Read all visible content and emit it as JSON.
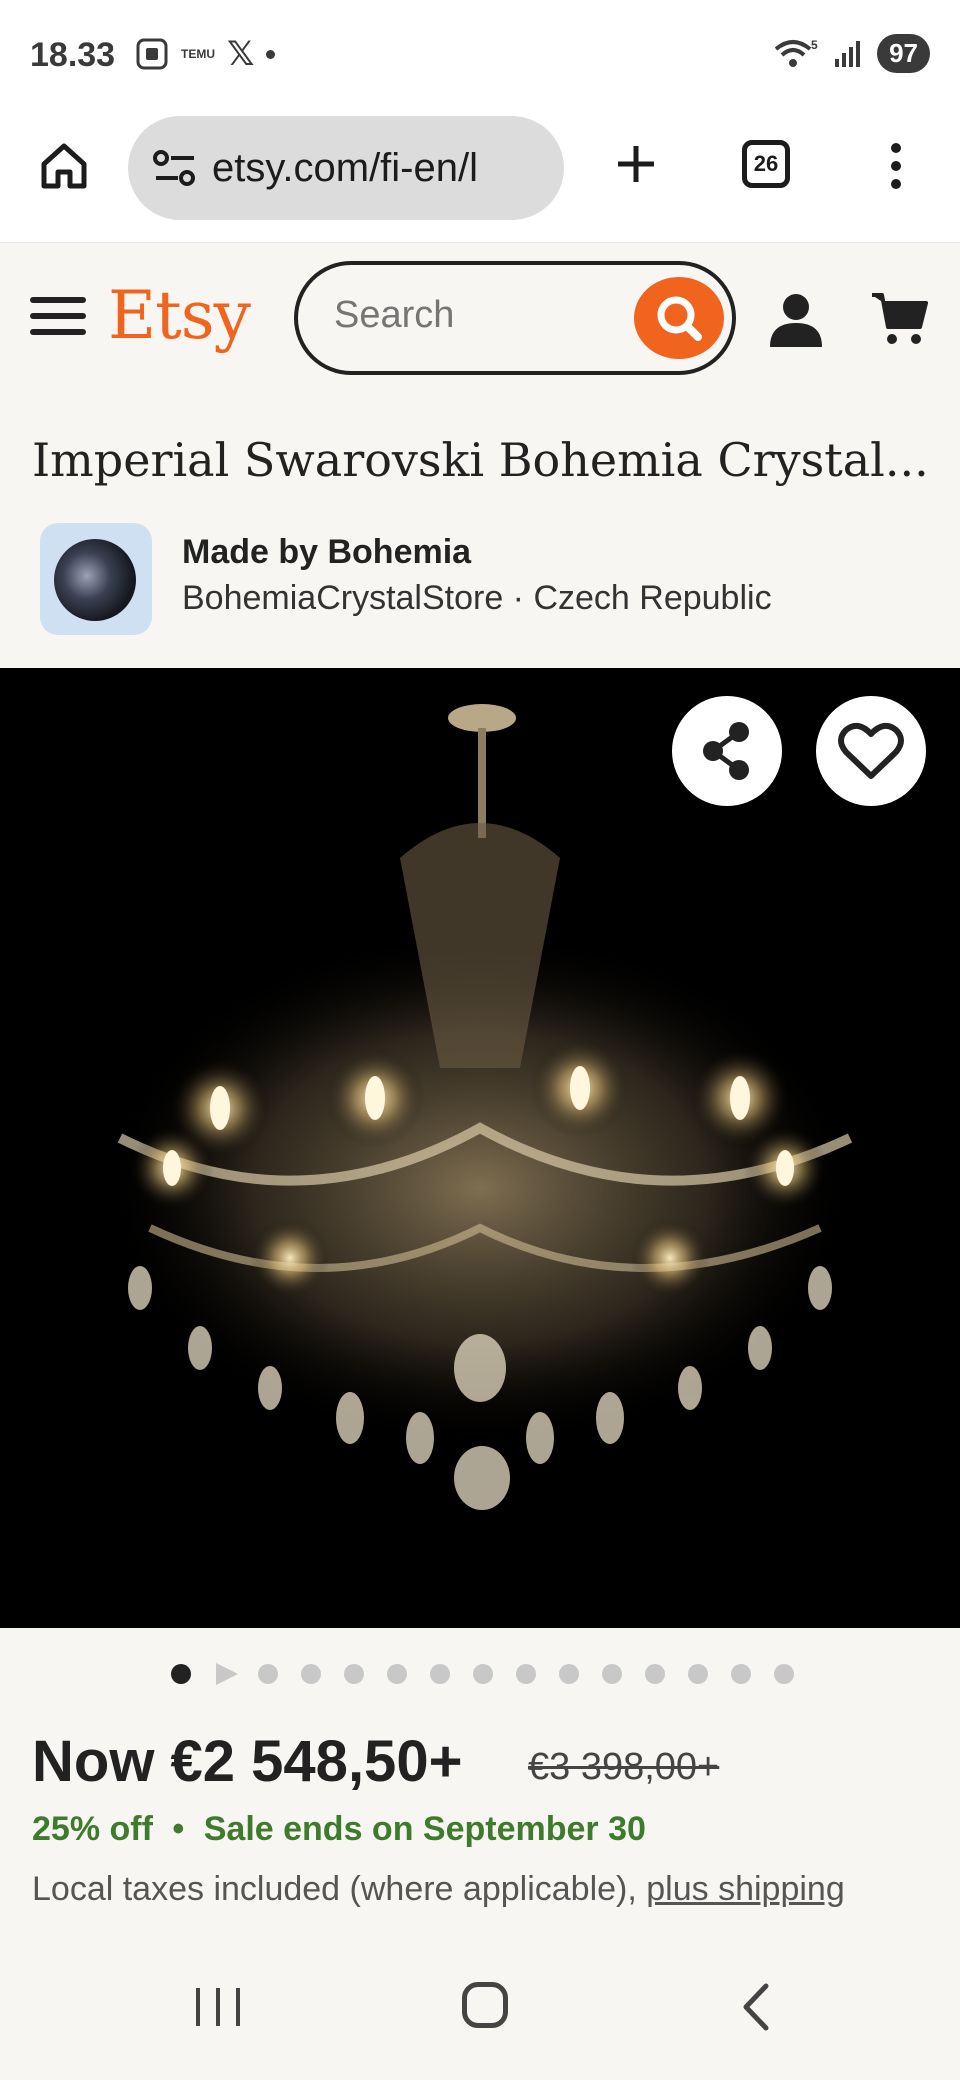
{
  "status_bar": {
    "time": "18.33",
    "temu_label": "TEMU",
    "battery": "97",
    "signal_label": "5"
  },
  "browser": {
    "url": "etsy.com/fi-en/l",
    "tab_count": "26"
  },
  "header": {
    "logo": "Etsy",
    "search_placeholder": "Search"
  },
  "listing": {
    "title": "Imperial Swarovski Bohemia Crystal...",
    "made_by": "Made by Bohemia",
    "shop": "BohemiaCrystalStore · Czech Republic"
  },
  "carousel": {
    "total_slides": 15,
    "active_index": 0,
    "second_is_video": true
  },
  "price": {
    "now": "Now €2 548,50+",
    "original": "€3 398,00+",
    "discount": "25% off",
    "separator": "•",
    "sale_end": "Sale ends on September 30",
    "tax_text": "Local taxes included (where applicable), ",
    "shipping_link": "plus shipping"
  },
  "colors": {
    "etsy_orange": "#f1641e",
    "sale_green": "#3e7b2c",
    "page_bg": "#f8f6f2"
  },
  "icons": [
    "home-icon",
    "site-settings-icon",
    "plus-icon",
    "tabs-icon",
    "more-vert-icon",
    "menu-icon",
    "search-icon",
    "user-icon",
    "cart-icon",
    "share-icon",
    "heart-icon",
    "play-icon",
    "recent-apps-icon",
    "nav-home-icon",
    "back-icon"
  ]
}
